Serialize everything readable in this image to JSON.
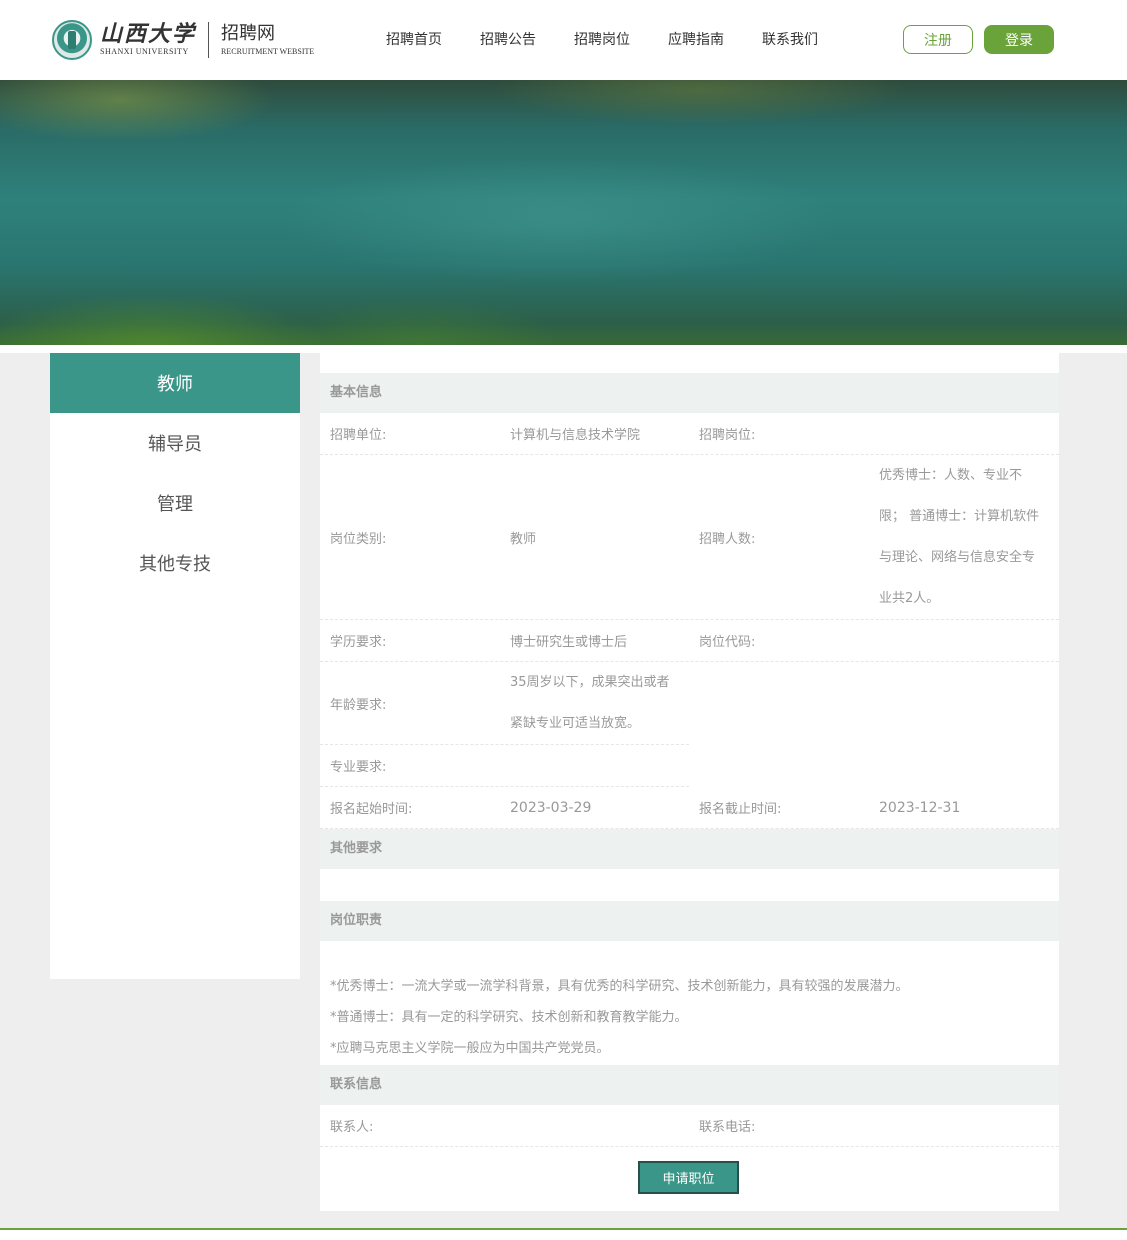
{
  "header": {
    "university_cn": "山西大学",
    "university_en": "SHANXI UNIVERSITY",
    "site_cn": "招聘网",
    "site_en": "RECRUITMENT WEBSITE",
    "nav": [
      "招聘首页",
      "招聘公告",
      "招聘岗位",
      "应聘指南",
      "联系我们"
    ],
    "register_label": "注册",
    "login_label": "登录"
  },
  "sidebar": {
    "items": [
      {
        "label": "教师",
        "active": true
      },
      {
        "label": "辅导员",
        "active": false
      },
      {
        "label": "管理",
        "active": false
      },
      {
        "label": "其他专技",
        "active": false
      }
    ]
  },
  "basic": {
    "title": "基本信息",
    "unit_label": "招聘单位:",
    "unit_value": "计算机与信息技术学院",
    "post_label": "招聘岗位:",
    "post_value": "",
    "category_label": "岗位类别:",
    "category_value": "教师",
    "count_label": "招聘人数:",
    "count_value": "优秀博士：人数、专业不限；普通博士：计算机软件与理论、网络与信息安全专业共2人。",
    "count_lines": [
      "优秀博士：人数、专业不",
      "限； 普通博士：计算机软件",
      "与理论、网络与信息安全专",
      "业共2人。"
    ],
    "edu_label": "学历要求:",
    "edu_value": "博士研究生或博士后",
    "code_label": "岗位代码:",
    "code_value": "",
    "age_label": "年龄要求:",
    "age_lines": [
      "35周岁以下，成果突出或者",
      "紧缺专业可适当放宽。"
    ],
    "major_label": "专业要求:",
    "major_value": "",
    "start_label": "报名起始时间:",
    "start_value": "2023-03-29",
    "end_label": "报名截止时间:",
    "end_value": "2023-12-31"
  },
  "other": {
    "title": "其他要求"
  },
  "duty": {
    "title": "岗位职责",
    "lines": [
      "*优秀博士：一流大学或一流学科背景，具有优秀的科学研究、技术创新能力，具有较强的发展潜力。",
      "*普通博士：具有一定的科学研究、技术创新和教育教学能力。",
      "*应聘马克思主义学院一般应为中国共产党党员。"
    ]
  },
  "contact": {
    "title": "联系信息",
    "person_label": "联系人:",
    "person_value": "",
    "phone_label": "联系电话:",
    "phone_value": ""
  },
  "apply_label": "申请职位",
  "colors": {
    "teal": "#3a9688",
    "green": "#6aa33a",
    "section_bg": "#edf2f0"
  }
}
